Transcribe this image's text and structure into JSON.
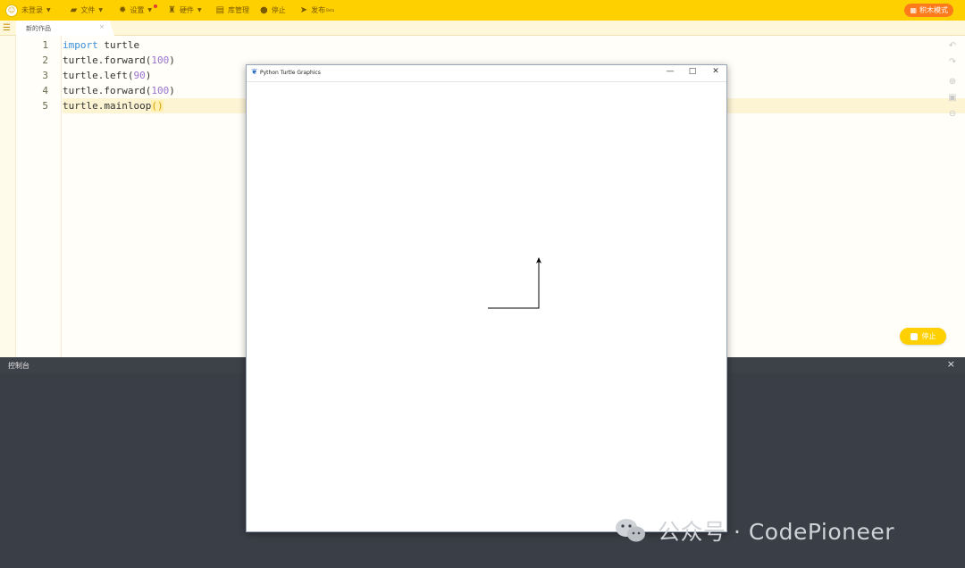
{
  "toolbar": {
    "login_label": "未登录",
    "file_label": "文件",
    "settings_label": "设置",
    "hardware_label": "硬件",
    "library_label": "库管理",
    "stop_label": "停止",
    "publish_label": "发布",
    "publish_sup": "Beta",
    "mode_label": "积木模式"
  },
  "tab": {
    "name": "新的作品",
    "close": "×"
  },
  "editor": {
    "line_numbers": [
      "1",
      "2",
      "3",
      "4",
      "5"
    ],
    "code": [
      {
        "kw": "import",
        "rest": " turtle"
      },
      {
        "pre": "turtle.forward(",
        "num": "100",
        "post": ")"
      },
      {
        "pre": "turtle.left(",
        "num": "90",
        "post": ")"
      },
      {
        "pre": "turtle.forward(",
        "num": "100",
        "post": ")"
      },
      {
        "pre": "turtle.mainloop",
        "hl": "()"
      }
    ]
  },
  "stop_button": {
    "label": "停止"
  },
  "console": {
    "title": "控制台",
    "close": "×"
  },
  "turtle_window": {
    "title": "Python Turtle Graphics",
    "minimize": "—",
    "maximize": "□",
    "close": "✕"
  },
  "watermark": {
    "text": "公众号 · CodePioneer"
  },
  "colors": {
    "accent": "#ffd000",
    "mode_button": "#ff7a1a",
    "console_bg": "#3a3e46"
  }
}
